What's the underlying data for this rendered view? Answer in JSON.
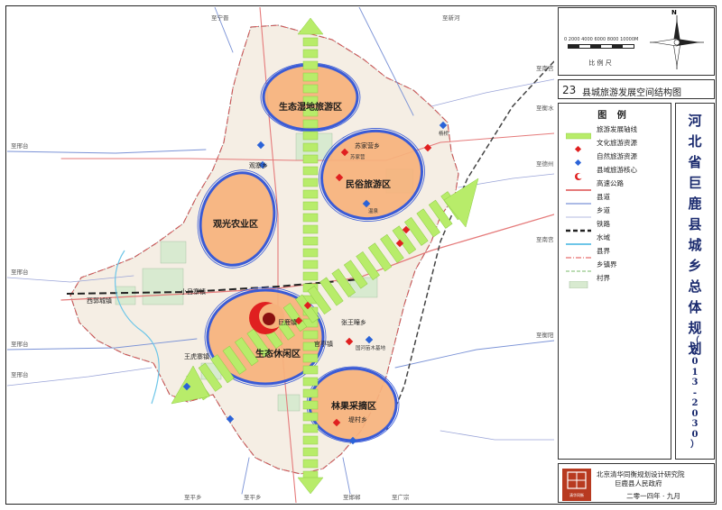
{
  "map": {
    "number": "23",
    "name": "县城旅游发展空间结构图",
    "scale_label": "比  例  尺",
    "scale_ticks": [
      "0",
      "2000",
      "4000",
      "6000",
      "8000",
      "10000M"
    ],
    "compass_label": "N",
    "zones": [
      {
        "label": "生态湿地旅游区"
      },
      {
        "label": "民俗旅游区"
      },
      {
        "label": "观光农业区"
      },
      {
        "label": "生态休闲区"
      },
      {
        "label": "林果采摘区"
      }
    ],
    "places": [
      "西郭城镇",
      "小吕寨镇",
      "王虎寨镇",
      "张王疃乡",
      "堤村乡",
      "观寨乡",
      "苏家营乡",
      "巨鹿镇",
      "官亭镇"
    ],
    "border_labels": [
      "至宁晋",
      "至新河",
      "至南宫",
      "至德州",
      "至邢台",
      "至邢台",
      "至邢台",
      "至邢台",
      "至南宫",
      "至衡水",
      "至平乡",
      "至平乡",
      "至广宗",
      "至邯郸",
      "至衡阳"
    ],
    "resource_labels": [
      "杨桥",
      "温泉",
      "国河苗木基地",
      "苏家营"
    ]
  },
  "legend": {
    "title": "图 例",
    "items": [
      {
        "label": "旅游发展轴线",
        "symbol": "axis"
      },
      {
        "label": "文化旅游资源",
        "symbol": "red-diamond"
      },
      {
        "label": "自然旅游资源",
        "symbol": "blue-diamond"
      },
      {
        "label": "县域旅游核心",
        "symbol": "core"
      },
      {
        "label": "高速公路",
        "symbol": "expressway"
      },
      {
        "label": "县道",
        "symbol": "county-road"
      },
      {
        "label": "乡道",
        "symbol": "township-road"
      },
      {
        "label": "铁路",
        "symbol": "railway"
      },
      {
        "label": "水域",
        "symbol": "water"
      },
      {
        "label": "县界",
        "symbol": "county-border"
      },
      {
        "label": "乡镇界",
        "symbol": "township-border"
      },
      {
        "label": "村界",
        "symbol": "village"
      }
    ]
  },
  "plan_title": "河北省巨鹿县城乡总体规划",
  "plan_years": "（2013-2030）",
  "institution": {
    "line1": "北京清华同衡规划设计研究院",
    "line2": "巨鹿县人民政府",
    "logo_text": "清华同衡"
  },
  "date": "二零一四年 · 九月",
  "colors": {
    "zone_fill": "#f6b27c",
    "zone_outline": "#3a5bd6",
    "axis_green": "#b8ec6a",
    "core_red": "#e02020",
    "title_blue": "#1a2a6e",
    "county_fill": "#f5eee4"
  }
}
